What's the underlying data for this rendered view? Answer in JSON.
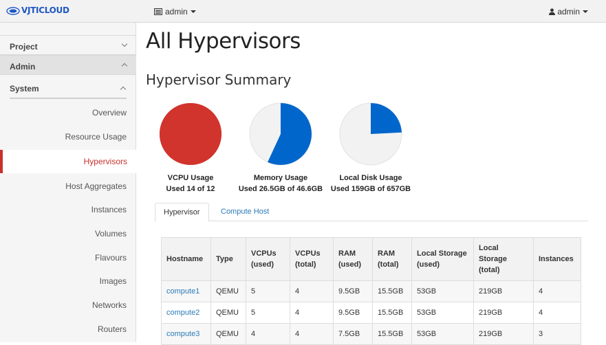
{
  "brand": {
    "name": "VJTICLOUD"
  },
  "header": {
    "project_label": "admin",
    "user_label": "admin"
  },
  "sidebar": {
    "categories": [
      {
        "label": "Project"
      },
      {
        "label": "Admin"
      }
    ],
    "system_label": "System",
    "items": [
      {
        "label": "Overview"
      },
      {
        "label": "Resource Usage"
      },
      {
        "label": "Hypervisors"
      },
      {
        "label": "Host Aggregates"
      },
      {
        "label": "Instances"
      },
      {
        "label": "Volumes"
      },
      {
        "label": "Flavours"
      },
      {
        "label": "Images"
      },
      {
        "label": "Networks"
      },
      {
        "label": "Routers"
      }
    ]
  },
  "main": {
    "title": "All Hypervisors",
    "summary_title": "Hypervisor Summary",
    "pies": [
      {
        "label": "VCPU Usage",
        "sub": "Used 14 of 12",
        "fraction": 1.0,
        "color": "#d0342c"
      },
      {
        "label": "Memory Usage",
        "sub": "Used 26.5GB of 46.6GB",
        "fraction": 0.569,
        "color": "#0066cc"
      },
      {
        "label": "Local Disk Usage",
        "sub": "Used 159GB of 657GB",
        "fraction": 0.242,
        "color": "#0066cc"
      }
    ],
    "tabs": [
      {
        "label": "Hypervisor"
      },
      {
        "label": "Compute Host"
      }
    ],
    "table": {
      "headers": [
        "Hostname",
        "Type",
        "VCPUs (used)",
        "VCPUs (total)",
        "RAM (used)",
        "RAM (total)",
        "Local Storage (used)",
        "Local Storage (total)",
        "Instances"
      ],
      "rows": [
        [
          "compute1",
          "QEMU",
          "5",
          "4",
          "9.5GB",
          "15.5GB",
          "53GB",
          "219GB",
          "4"
        ],
        [
          "compute2",
          "QEMU",
          "5",
          "4",
          "9.5GB",
          "15.5GB",
          "53GB",
          "219GB",
          "4"
        ],
        [
          "compute3",
          "QEMU",
          "4",
          "4",
          "7.5GB",
          "15.5GB",
          "53GB",
          "219GB",
          "3"
        ]
      ]
    }
  },
  "colors": {
    "accent": "#c9302c",
    "link": "#2a7ab8",
    "pie_bg": "#f2f2f2"
  }
}
